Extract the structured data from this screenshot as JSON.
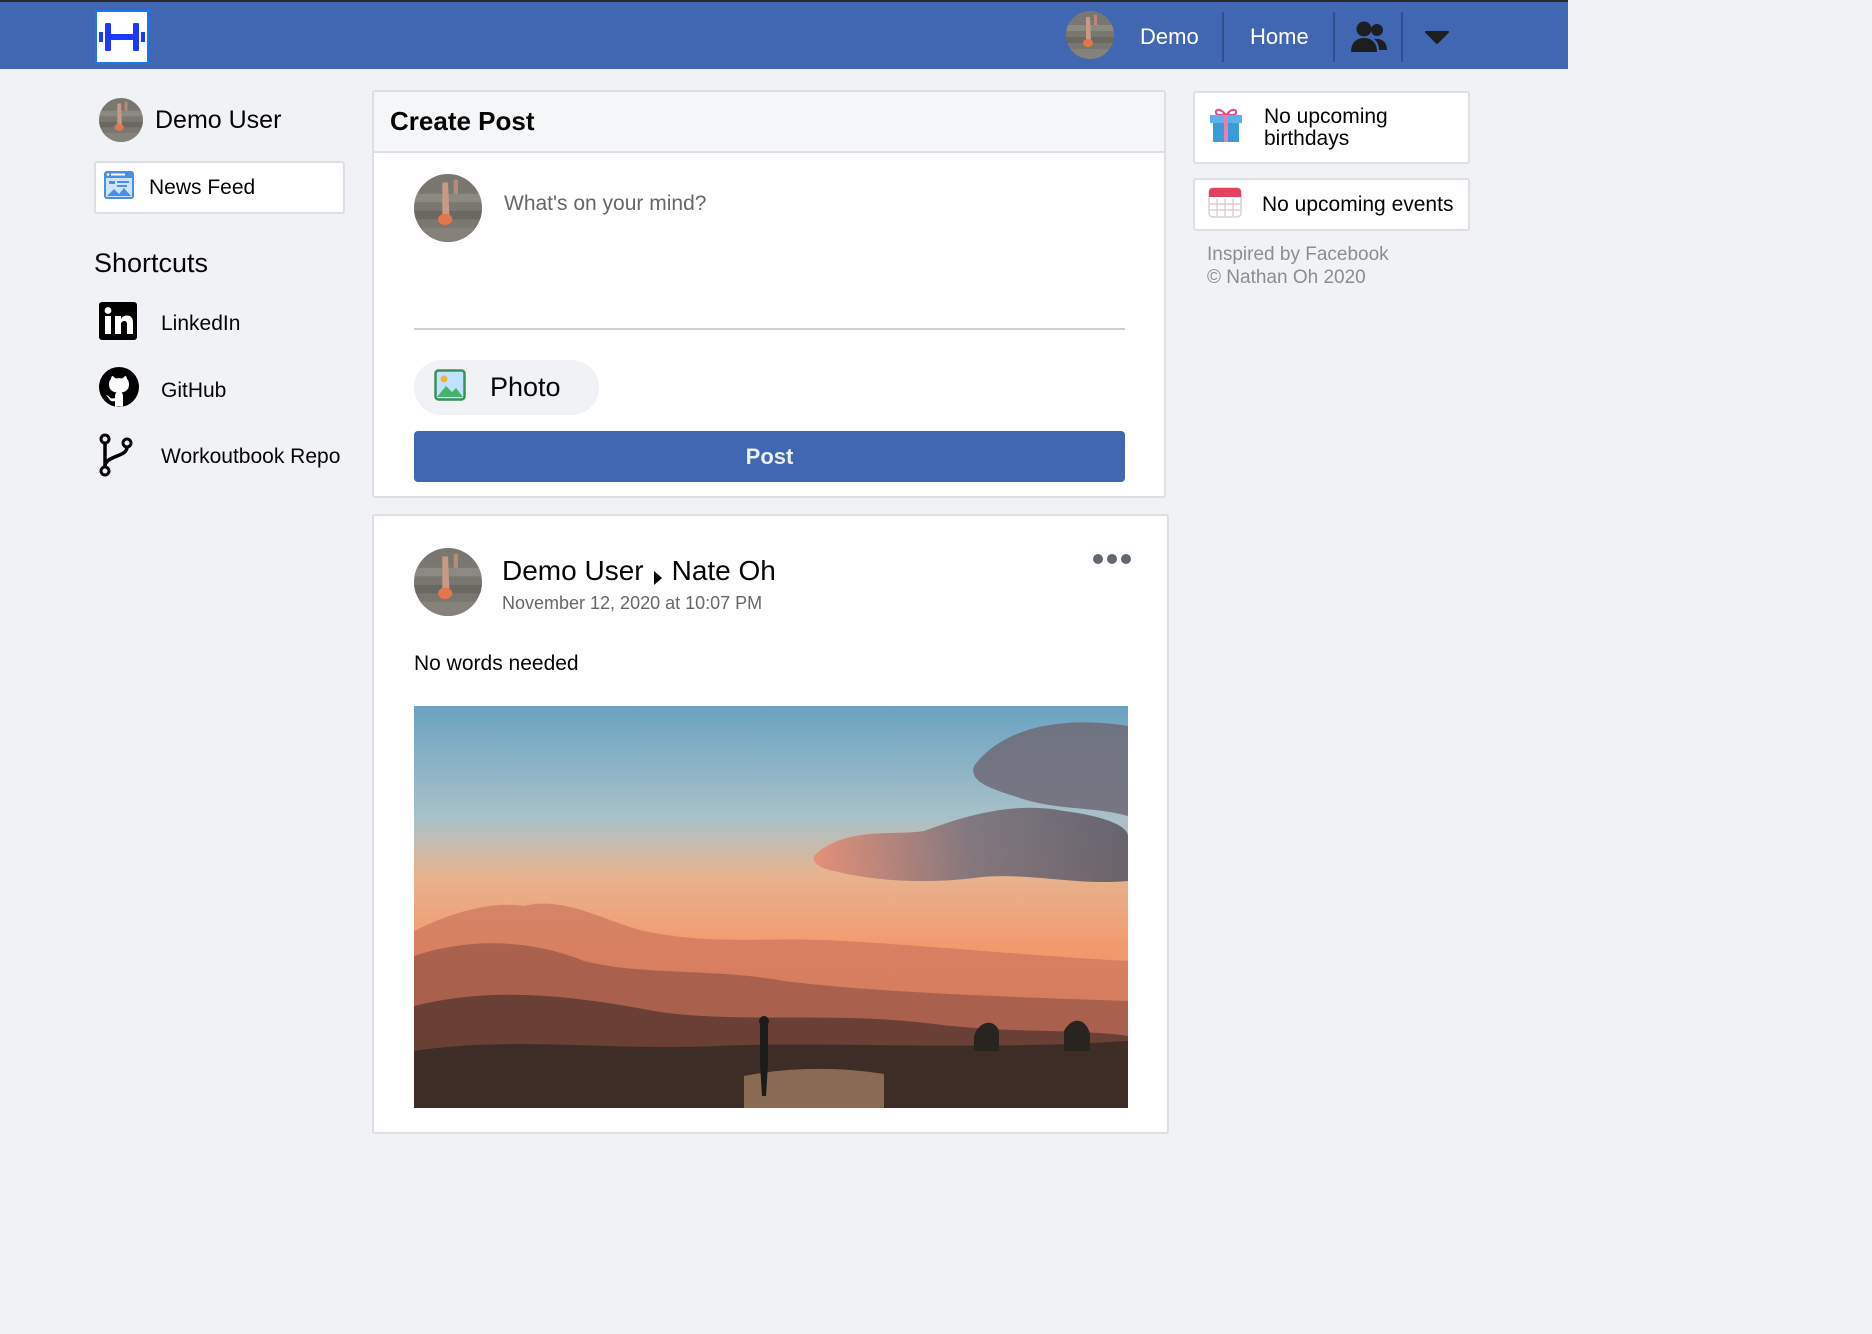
{
  "nav": {
    "logo_icon": "dumbbell-logo",
    "user_label": "Demo",
    "home_label": "Home",
    "friends_icon": "friends-icon",
    "menu_icon": "caret-down-icon",
    "bar_color": "#4267b2"
  },
  "sidebar": {
    "profile_name": "Demo User",
    "news_feed_label": "News Feed",
    "shortcuts_title": "Shortcuts",
    "shortcuts": [
      {
        "label": "LinkedIn",
        "icon": "linkedin-icon"
      },
      {
        "label": "GitHub",
        "icon": "github-icon"
      },
      {
        "label": "Workoutbook Repo",
        "icon": "git-branch-icon"
      }
    ]
  },
  "create_post": {
    "title": "Create Post",
    "placeholder": "What's on your mind?",
    "photo_label": "Photo",
    "post_label": "Post"
  },
  "feed": {
    "posts": [
      {
        "author": "Demo User",
        "recipient": "Nate Oh",
        "timestamp": "November 12, 2020 at 10:07 PM",
        "body": "No words needed",
        "image": "sunset-mountain-landscape"
      }
    ]
  },
  "right_sidebar": {
    "birthdays": "No upcoming birthdays",
    "events": "No upcoming events",
    "footer": {
      "line1": "Inspired by Facebook",
      "line2": "© Nathan Oh 2020"
    }
  }
}
